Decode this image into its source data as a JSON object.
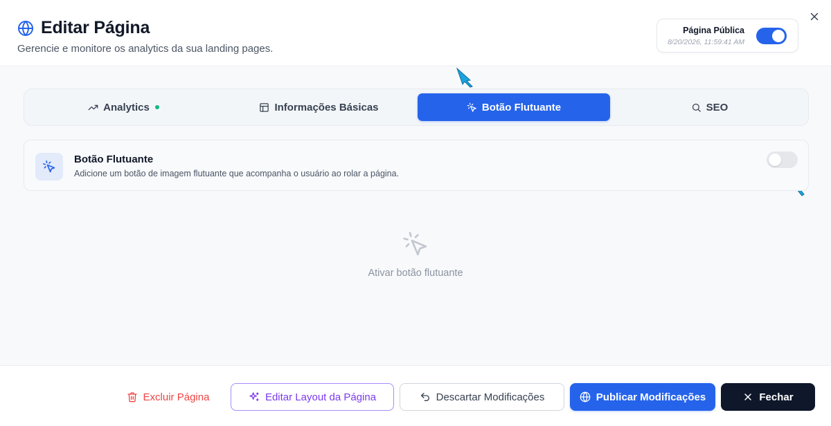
{
  "header": {
    "title": "Editar Página",
    "subtitle": "Gerencie e monitore os analytics da sua landing pages.",
    "title_icon": "globe-icon",
    "public_label": "Página Pública",
    "public_date": "8/20/2026, 11:59:41 AM",
    "public_enabled": true,
    "close_icon": "close-icon"
  },
  "tabs": [
    {
      "label": "Analytics",
      "icon": "trending-up-icon",
      "active": false,
      "status_dot": true
    },
    {
      "label": "Informações Básicas",
      "icon": "layout-icon",
      "active": false
    },
    {
      "label": "Botão Flutuante",
      "icon": "pointer-click-icon",
      "active": true
    },
    {
      "label": "SEO",
      "icon": "search-icon",
      "active": false
    }
  ],
  "floating_button": {
    "title": "Botão Flutuante",
    "description": "Adicione um botão de imagem flutuante que acompanha o usuário ao rolar a página.",
    "enabled": false,
    "empty_state": "Ativar botão flutuante"
  },
  "footer": {
    "delete_label": "Excluir Página",
    "edit_layout_label": "Editar Layout da Página",
    "discard_label": "Descartar Modificações",
    "publish_label": "Publicar Modificações",
    "close_label": "Fechar"
  },
  "colors": {
    "accent": "#2563eb",
    "danger": "#ef4444",
    "purple": "#7c3aed",
    "dark": "#0f172a",
    "annotation_arrow": "#1aa3e0",
    "analytics_dot": "#10b981"
  }
}
